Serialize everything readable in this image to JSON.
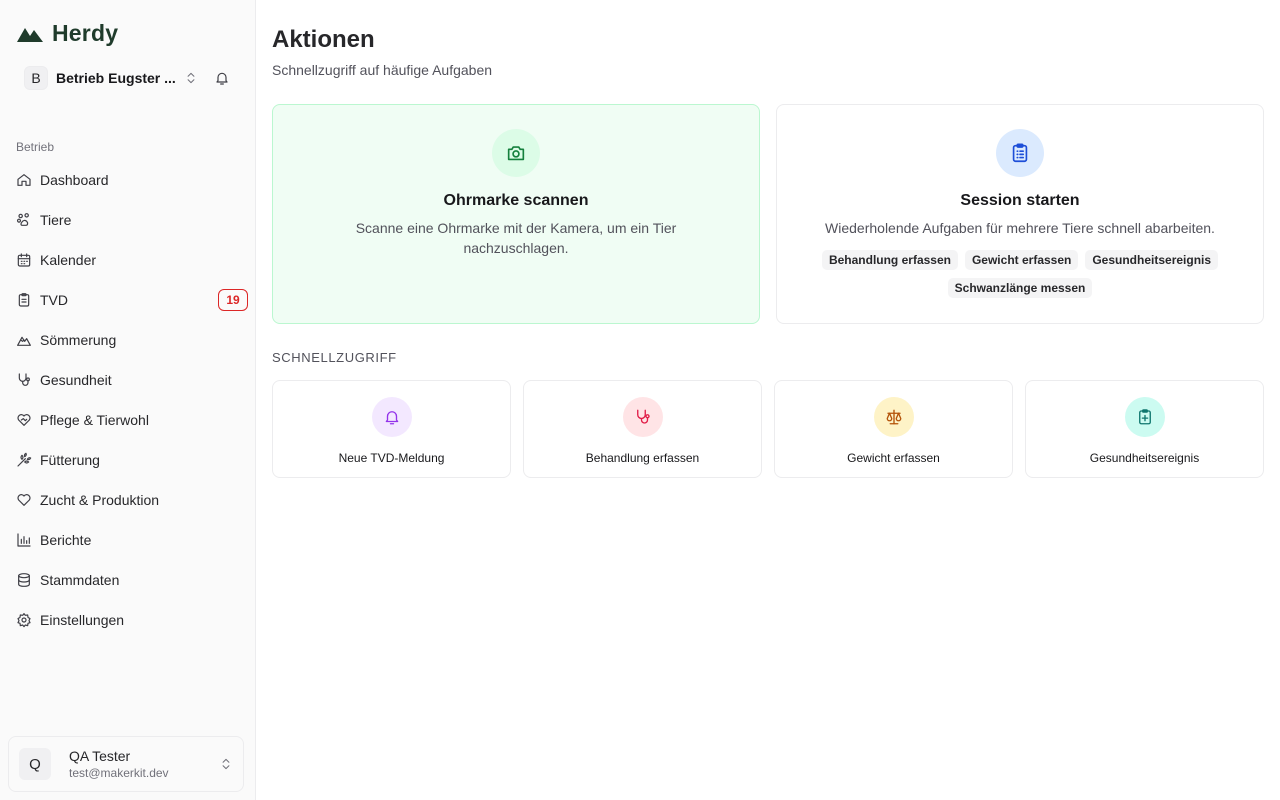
{
  "brand": {
    "name": "Herdy",
    "color": "#1f3b2b"
  },
  "org": {
    "initial": "B",
    "name": "Betrieb Eugster ..."
  },
  "sidebar": {
    "section_label": "Betrieb",
    "items": [
      {
        "label": "Dashboard",
        "icon": "home-icon"
      },
      {
        "label": "Tiere",
        "icon": "paw-icon"
      },
      {
        "label": "Kalender",
        "icon": "calendar-icon"
      },
      {
        "label": "TVD",
        "icon": "clipboard-icon",
        "badge": "19"
      },
      {
        "label": "Sömmerung",
        "icon": "mountain-icon"
      },
      {
        "label": "Gesundheit",
        "icon": "stethoscope-icon"
      },
      {
        "label": "Pflege & Tierwohl",
        "icon": "heart-handshake-icon"
      },
      {
        "label": "Fütterung",
        "icon": "wheat-icon"
      },
      {
        "label": "Zucht & Produktion",
        "icon": "heart-icon"
      },
      {
        "label": "Berichte",
        "icon": "bar-chart-icon"
      },
      {
        "label": "Stammdaten",
        "icon": "database-icon"
      },
      {
        "label": "Einstellungen",
        "icon": "settings-icon"
      }
    ]
  },
  "user": {
    "initial": "Q",
    "name": "QA Tester",
    "email": "test@makerkit.dev"
  },
  "main": {
    "title": "Aktionen",
    "subtitle": "Schnellzugriff auf häufige Aufgaben",
    "scan_card": {
      "title": "Ohrmarke scannen",
      "description": "Scanne eine Ohrmarke mit der Kamera, um ein Tier nachzuschlagen.",
      "icon": "camera-icon",
      "accent": "#15803d"
    },
    "session_card": {
      "title": "Session starten",
      "description": "Wiederholende Aufgaben für mehrere Tiere schnell abarbeiten.",
      "icon": "clipboard-list-icon",
      "accent": "#1d4ed8",
      "tags": [
        "Behandlung erfassen",
        "Gewicht erfassen",
        "Gesundheitsereignis",
        "Schwanzlänge messen"
      ]
    },
    "quick_section_label": "SCHNELLZUGRIFF",
    "quick_actions": [
      {
        "label": "Neue TVD-Meldung",
        "icon": "bell-icon",
        "color": "#9333ea"
      },
      {
        "label": "Behandlung erfassen",
        "icon": "stethoscope-icon",
        "color": "#e11d48"
      },
      {
        "label": "Gewicht erfassen",
        "icon": "scale-icon",
        "color": "#b45309"
      },
      {
        "label": "Gesundheitsereignis",
        "icon": "clipboard-plus-icon",
        "color": "#0f766e"
      }
    ]
  }
}
